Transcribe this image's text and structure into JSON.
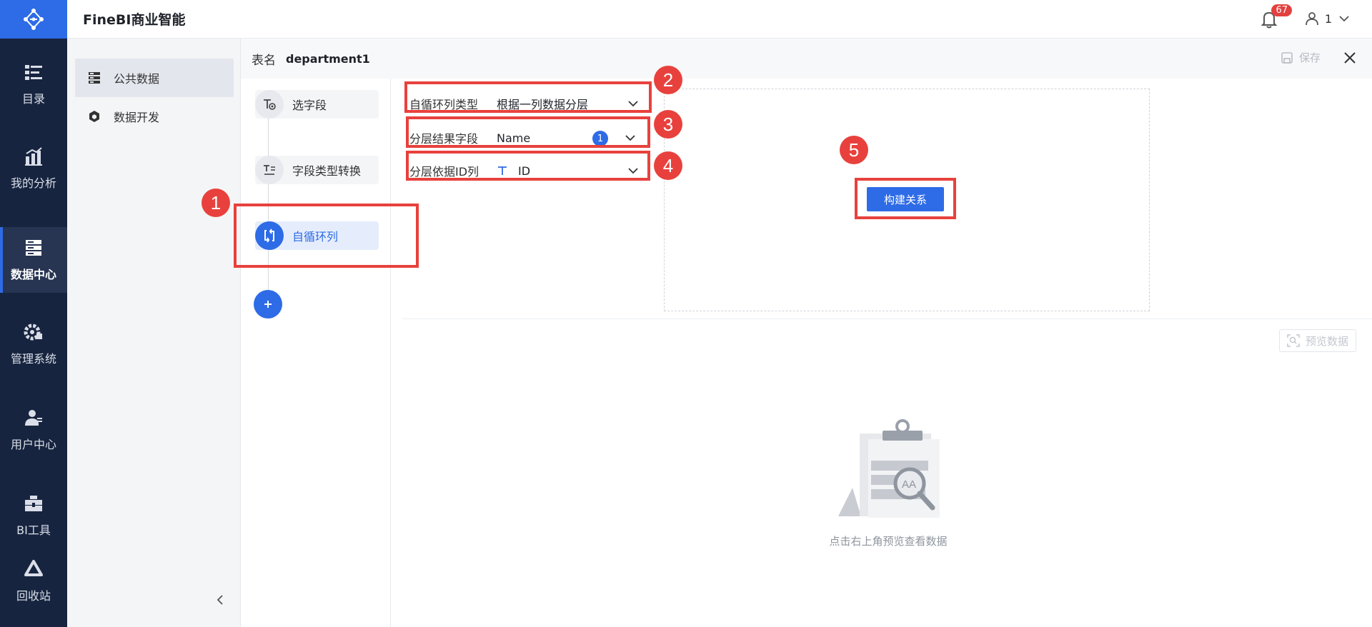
{
  "app": {
    "title": "FineBI商业智能"
  },
  "header": {
    "notification_count": "67",
    "user_name": "1"
  },
  "nav": {
    "items": [
      {
        "label": "目录"
      },
      {
        "label": "我的分析"
      },
      {
        "label": "数据中心"
      },
      {
        "label": "管理系统"
      },
      {
        "label": "用户中心"
      },
      {
        "label": "BI工具"
      },
      {
        "label": "回收站"
      }
    ]
  },
  "sub_sidebar": {
    "items": [
      {
        "label": "公共数据"
      },
      {
        "label": "数据开发"
      }
    ]
  },
  "tabbar": {
    "table_label": "表名",
    "table_name": "department1",
    "save_label": "保存"
  },
  "steps": [
    {
      "label": "选字段"
    },
    {
      "label": "字段类型转换"
    },
    {
      "label": "自循环列"
    }
  ],
  "config": {
    "type_label": "自循环列类型",
    "type_value": "根据一列数据分层",
    "result_label": "分层结果字段",
    "result_value": "Name",
    "result_count": "1",
    "id_label": "分层依据ID列",
    "id_value": "ID",
    "build_button": "构建关系"
  },
  "preview": {
    "button_label": "预览数据",
    "empty_text": "点击右上角预览查看数据",
    "illustration_text": "AA"
  },
  "annotations": [
    "1",
    "2",
    "3",
    "4",
    "5"
  ],
  "colors": {
    "primary": "#2e6be6",
    "nav_bg": "#17243f",
    "annotation": "#e8413d"
  }
}
